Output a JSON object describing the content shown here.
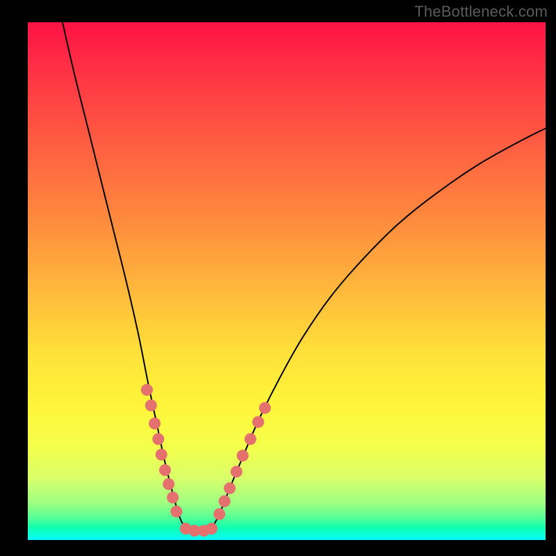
{
  "watermark": "TheBottleneck.com",
  "chart_data": {
    "type": "line",
    "title": "",
    "xlabel": "",
    "ylabel": "",
    "xlim": [
      0,
      100
    ],
    "ylim": [
      0,
      100
    ],
    "curves": [
      {
        "name": "left-branch",
        "points": [
          {
            "x": 6.7,
            "y": 100.0
          },
          {
            "x": 9.0,
            "y": 90.0
          },
          {
            "x": 11.5,
            "y": 80.0
          },
          {
            "x": 14.0,
            "y": 70.0
          },
          {
            "x": 16.5,
            "y": 60.0
          },
          {
            "x": 19.0,
            "y": 50.0
          },
          {
            "x": 21.3,
            "y": 40.0
          },
          {
            "x": 23.3,
            "y": 30.0
          },
          {
            "x": 25.0,
            "y": 22.0
          },
          {
            "x": 26.5,
            "y": 15.0
          },
          {
            "x": 28.0,
            "y": 9.0
          },
          {
            "x": 29.3,
            "y": 4.5
          },
          {
            "x": 30.5,
            "y": 2.0
          }
        ]
      },
      {
        "name": "bottom-segment",
        "points": [
          {
            "x": 30.5,
            "y": 2.0
          },
          {
            "x": 32.0,
            "y": 1.8
          },
          {
            "x": 34.0,
            "y": 1.8
          },
          {
            "x": 35.5,
            "y": 2.2
          }
        ]
      },
      {
        "name": "right-branch",
        "points": [
          {
            "x": 35.5,
            "y": 2.2
          },
          {
            "x": 37.0,
            "y": 5.0
          },
          {
            "x": 39.0,
            "y": 10.0
          },
          {
            "x": 41.5,
            "y": 16.0
          },
          {
            "x": 44.5,
            "y": 23.0
          },
          {
            "x": 48.5,
            "y": 31.0
          },
          {
            "x": 53.0,
            "y": 39.0
          },
          {
            "x": 58.5,
            "y": 47.0
          },
          {
            "x": 64.5,
            "y": 54.0
          },
          {
            "x": 71.5,
            "y": 61.0
          },
          {
            "x": 79.0,
            "y": 67.0
          },
          {
            "x": 87.0,
            "y": 72.5
          },
          {
            "x": 95.0,
            "y": 77.0
          },
          {
            "x": 100.0,
            "y": 79.5
          }
        ]
      }
    ],
    "marker_clusters": [
      {
        "name": "left-markers",
        "color": "#e4716e",
        "points": [
          {
            "x": 23.0,
            "y": 29.0
          },
          {
            "x": 23.8,
            "y": 26.0
          },
          {
            "x": 24.5,
            "y": 22.5
          },
          {
            "x": 25.2,
            "y": 19.5
          },
          {
            "x": 25.8,
            "y": 16.5
          },
          {
            "x": 26.5,
            "y": 13.5
          },
          {
            "x": 27.2,
            "y": 10.8
          },
          {
            "x": 28.0,
            "y": 8.2
          },
          {
            "x": 28.7,
            "y": 5.5
          }
        ]
      },
      {
        "name": "bottom-markers",
        "color": "#e4716e",
        "points": [
          {
            "x": 30.5,
            "y": 2.2
          },
          {
            "x": 32.2,
            "y": 1.8
          },
          {
            "x": 34.0,
            "y": 1.8
          },
          {
            "x": 35.5,
            "y": 2.2
          }
        ]
      },
      {
        "name": "right-markers",
        "color": "#e4716e",
        "points": [
          {
            "x": 37.0,
            "y": 5.0
          },
          {
            "x": 38.0,
            "y": 7.5
          },
          {
            "x": 39.0,
            "y": 10.0
          },
          {
            "x": 40.3,
            "y": 13.2
          },
          {
            "x": 41.5,
            "y": 16.3
          },
          {
            "x": 43.0,
            "y": 19.5
          },
          {
            "x": 44.5,
            "y": 22.8
          },
          {
            "x": 45.8,
            "y": 25.5
          }
        ]
      }
    ]
  }
}
